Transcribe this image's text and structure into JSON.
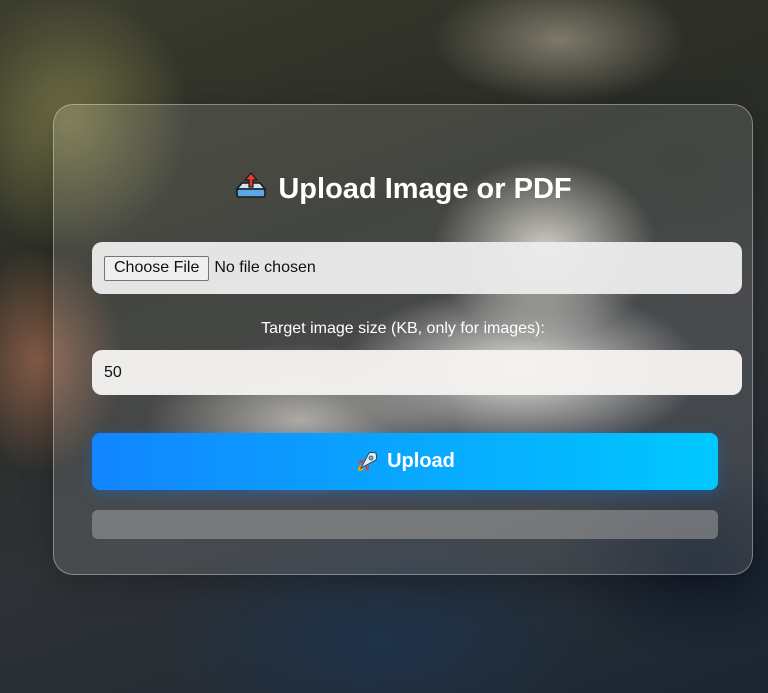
{
  "card": {
    "title": "Upload Image or PDF",
    "title_icon": "outbox-tray-icon"
  },
  "file_input": {
    "button_label": "Choose File",
    "status_text": "No file chosen"
  },
  "size_field": {
    "label": "Target image size (KB, only for images):",
    "value": "50"
  },
  "upload_button": {
    "label": "Upload",
    "icon": "rocket-icon"
  },
  "progress": {
    "value": 0
  },
  "colors": {
    "button_gradient_start": "#1285ff",
    "button_gradient_end": "#00c8ff",
    "title_text": "#ffffff"
  }
}
